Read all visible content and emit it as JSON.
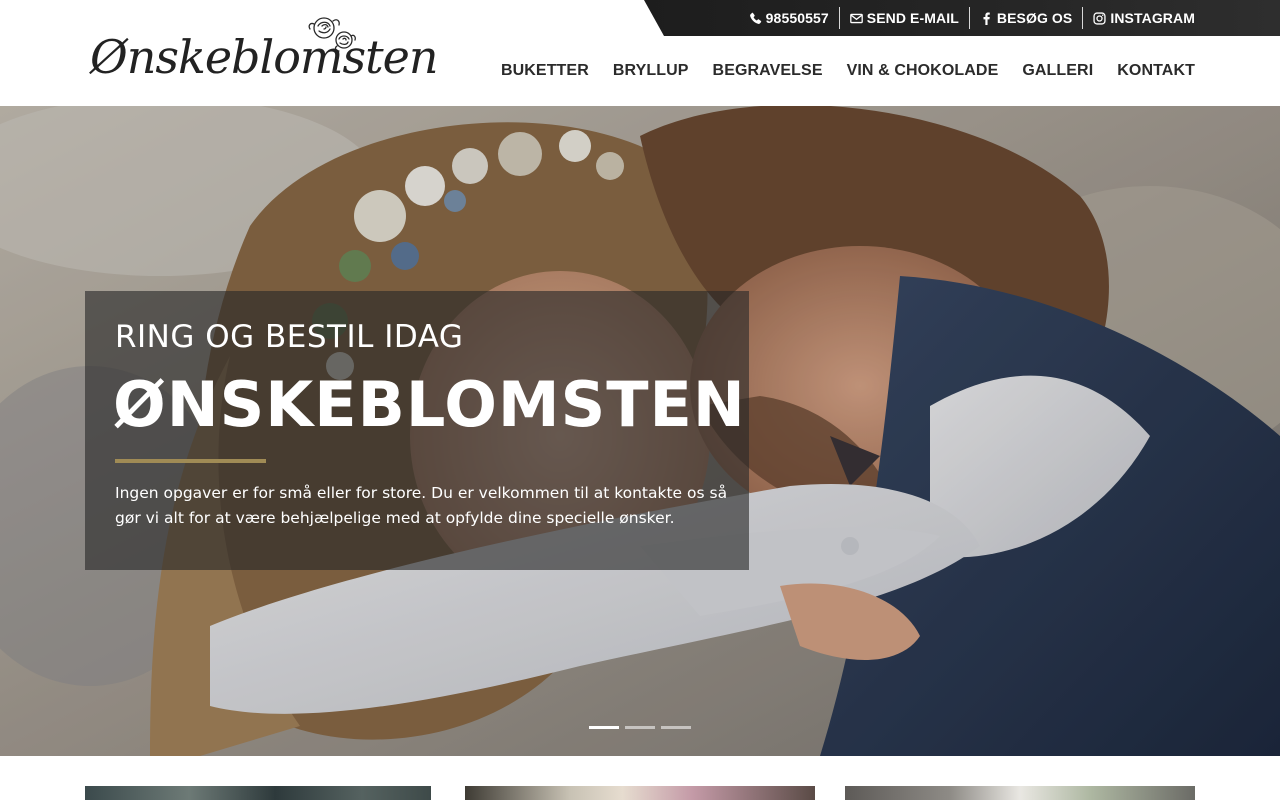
{
  "brand": {
    "logo_text": "Ønskeblomsten",
    "accent_color": "#a08b55",
    "topbar_color": "#222222"
  },
  "topbar": {
    "links": [
      {
        "label": "98550557",
        "icon": "phone-icon"
      },
      {
        "label": "SEND E-MAIL",
        "icon": "envelope-icon"
      },
      {
        "label": "BESØG OS",
        "icon": "facebook-icon"
      },
      {
        "label": "INSTAGRAM",
        "icon": "instagram-icon"
      }
    ]
  },
  "nav": {
    "items": [
      {
        "label": "BUKETTER"
      },
      {
        "label": "BRYLLUP"
      },
      {
        "label": "BEGRAVELSE"
      },
      {
        "label": "VIN & CHOKOLADE"
      },
      {
        "label": "GALLERI"
      },
      {
        "label": "KONTAKT"
      }
    ]
  },
  "hero": {
    "eyebrow": "RING OG BESTIL IDAG",
    "title": "ØNSKEBLOMSTEN",
    "text": "Ingen opgaver er for små eller for store. Du er velkommen til at kontakte os så gør vi alt for at være behjælpelige med at opfylde dine specielle ønsker.",
    "slides_total": 3,
    "active_slide": 1
  }
}
